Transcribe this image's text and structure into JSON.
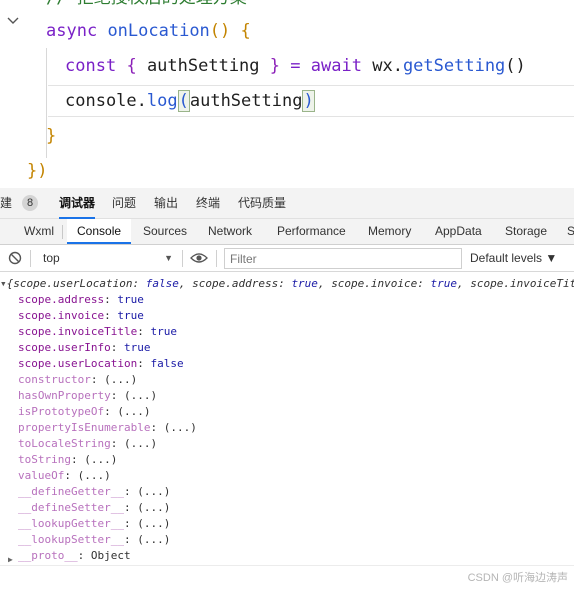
{
  "editor": {
    "comment_partial": "// 拒绝授权后的处理方案",
    "l2_async": "async",
    "l2_fn": "onLocation",
    "l2_parens": "()",
    "l2_brace": "{",
    "l3_const": "const",
    "l3_lbrace": "{",
    "l3_var": "authSetting",
    "l3_rbrace": "}",
    "l3_eq": "=",
    "l3_await": "await",
    "l3_wx": "wx.",
    "l3_fn": "getSetting",
    "l3_parens": "()",
    "l4_console": "console.",
    "l4_fn": "log",
    "l4_lparen": "(",
    "l4_arg": "authSetting",
    "l4_rparen": ")",
    "l5_close": "}",
    "l6_close": "})"
  },
  "top_tabs": {
    "build_partial": "建",
    "badge": "8",
    "debugger": "调试器",
    "issues": "问题",
    "output": "输出",
    "terminal": "终端",
    "quality": "代码质量"
  },
  "panel_tabs": [
    "Wxml",
    "Console",
    "Sources",
    "Network",
    "Performance",
    "Memory",
    "AppData",
    "Storage",
    "S"
  ],
  "toolbar": {
    "context": "top",
    "filter_placeholder": "Filter",
    "levels": "Default levels ▼"
  },
  "console": {
    "summary": {
      "open": "{",
      "k1": "scope.userLocation",
      "v1": "false",
      "k2": "scope.address",
      "v2": "true",
      "k3": "scope.invoice",
      "v3": "true",
      "k4": "scope.invoiceTit",
      "sep": ": ",
      "comma": ", "
    },
    "properties": [
      {
        "key": "scope.address",
        "value": "true"
      },
      {
        "key": "scope.invoice",
        "value": "true"
      },
      {
        "key": "scope.invoiceTitle",
        "value": "true"
      },
      {
        "key": "scope.userInfo",
        "value": "true"
      },
      {
        "key": "scope.userLocation",
        "value": "false"
      }
    ],
    "inherited": [
      {
        "key": "constructor",
        "value": "(...)"
      },
      {
        "key": "hasOwnProperty",
        "value": "(...)"
      },
      {
        "key": "isPrototypeOf",
        "value": "(...)"
      },
      {
        "key": "propertyIsEnumerable",
        "value": "(...)"
      },
      {
        "key": "toLocaleString",
        "value": "(...)"
      },
      {
        "key": "toString",
        "value": "(...)"
      },
      {
        "key": "valueOf",
        "value": "(...)"
      },
      {
        "key": "__defineGetter__",
        "value": "(...)"
      },
      {
        "key": "__defineSetter__",
        "value": "(...)"
      },
      {
        "key": "__lookupGetter__",
        "value": "(...)"
      },
      {
        "key": "__lookupSetter__",
        "value": "(...)"
      }
    ],
    "proto": {
      "key": "__proto__",
      "value": "Object"
    }
  },
  "watermark": "CSDN @听海边涛声",
  "colors": {
    "accent": "#1a73e8",
    "keyword": "#7a21c7",
    "function": "#2a59d1",
    "own_property": "#881391",
    "inherited_property": "#b871bd",
    "boolean": "#1a1aa6"
  }
}
